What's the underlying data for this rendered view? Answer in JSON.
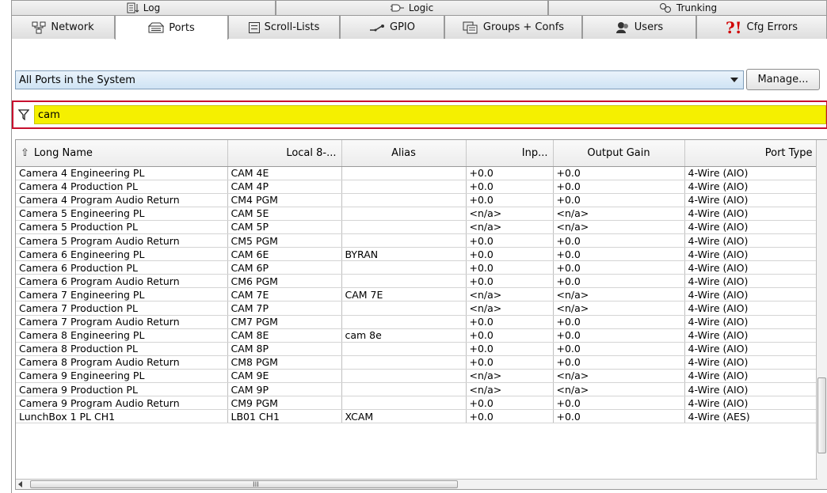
{
  "tabs_back": [
    {
      "label": "Log",
      "icon": "log-icon"
    },
    {
      "label": "Logic",
      "icon": "logic-icon"
    },
    {
      "label": "Trunking",
      "icon": "trunking-icon"
    }
  ],
  "tabs_front": [
    {
      "label": "Network",
      "icon": "network-icon"
    },
    {
      "label": "Ports",
      "icon": "ports-icon",
      "active": true
    },
    {
      "label": "Scroll-Lists",
      "icon": "scroll-lists-icon"
    },
    {
      "label": "GPIO",
      "icon": "gpio-icon"
    },
    {
      "label": "Groups + Confs",
      "icon": "groups-icon"
    },
    {
      "label": "Users",
      "icon": "users-icon"
    },
    {
      "label": "Cfg Errors",
      "icon": "cfg-errors-icon",
      "mark": "?!",
      "mark_color": "#d00000"
    }
  ],
  "selector": {
    "value": "All Ports in the System",
    "manage_label": "Manage..."
  },
  "filter": {
    "value": "cam",
    "highlight_color": "#f5f000",
    "border_color": "#c8102e"
  },
  "table": {
    "columns": [
      "Long Name",
      "Local 8-...",
      "Alias",
      "Inp...",
      "Output Gain",
      "Port Type"
    ],
    "rows": [
      [
        "Camera 4 Engineering PL",
        "CAM 4E",
        "",
        "+0.0",
        "+0.0",
        "4-Wire (AIO)"
      ],
      [
        "Camera 4 Production PL",
        "CAM 4P",
        "",
        "+0.0",
        "+0.0",
        "4-Wire (AIO)"
      ],
      [
        "Camera 4 Program Audio Return",
        "CM4 PGM",
        "",
        "+0.0",
        "+0.0",
        "4-Wire (AIO)"
      ],
      [
        "Camera 5 Engineering PL",
        "CAM 5E",
        "",
        "<n/a>",
        "<n/a>",
        "4-Wire (AIO)"
      ],
      [
        "Camera 5 Production PL",
        "CAM 5P",
        "",
        "<n/a>",
        "<n/a>",
        "4-Wire (AIO)"
      ],
      [
        "Camera 5 Program Audio Return",
        "CM5 PGM",
        "",
        "+0.0",
        "+0.0",
        "4-Wire (AIO)"
      ],
      [
        "Camera 6 Engineering PL",
        "CAM 6E",
        "BYRAN",
        "+0.0",
        "+0.0",
        "4-Wire (AIO)"
      ],
      [
        "Camera 6 Production PL",
        "CAM 6P",
        "",
        "+0.0",
        "+0.0",
        "4-Wire (AIO)"
      ],
      [
        "Camera 6 Program Audio Return",
        "CM6 PGM",
        "",
        "+0.0",
        "+0.0",
        "4-Wire (AIO)"
      ],
      [
        "Camera 7 Engineering PL",
        "CAM 7E",
        "CAM 7E",
        "<n/a>",
        "<n/a>",
        "4-Wire (AIO)"
      ],
      [
        "Camera 7 Production PL",
        "CAM 7P",
        "",
        "<n/a>",
        "<n/a>",
        "4-Wire (AIO)"
      ],
      [
        "Camera 7 Program Audio Return",
        "CM7 PGM",
        "",
        "+0.0",
        "+0.0",
        "4-Wire (AIO)"
      ],
      [
        "Camera 8 Engineering PL",
        "CAM 8E",
        "cam 8e",
        "+0.0",
        "+0.0",
        "4-Wire (AIO)"
      ],
      [
        "Camera 8 Production PL",
        "CAM 8P",
        "",
        "+0.0",
        "+0.0",
        "4-Wire (AIO)"
      ],
      [
        "Camera 8 Program Audio Return",
        "CM8 PGM",
        "",
        "+0.0",
        "+0.0",
        "4-Wire (AIO)"
      ],
      [
        "Camera 9 Engineering PL",
        "CAM 9E",
        "",
        "<n/a>",
        "<n/a>",
        "4-Wire (AIO)"
      ],
      [
        "Camera 9 Production PL",
        "CAM 9P",
        "",
        "<n/a>",
        "<n/a>",
        "4-Wire (AIO)"
      ],
      [
        "Camera 9 Program Audio Return",
        "CM9 PGM",
        "",
        "+0.0",
        "+0.0",
        "4-Wire (AIO)"
      ],
      [
        "LunchBox 1 PL CH1",
        "LB01 CH1",
        "XCAM",
        "+0.0",
        "+0.0",
        "4-Wire (AES)"
      ]
    ]
  },
  "scrollbar": {
    "grip": "III"
  }
}
